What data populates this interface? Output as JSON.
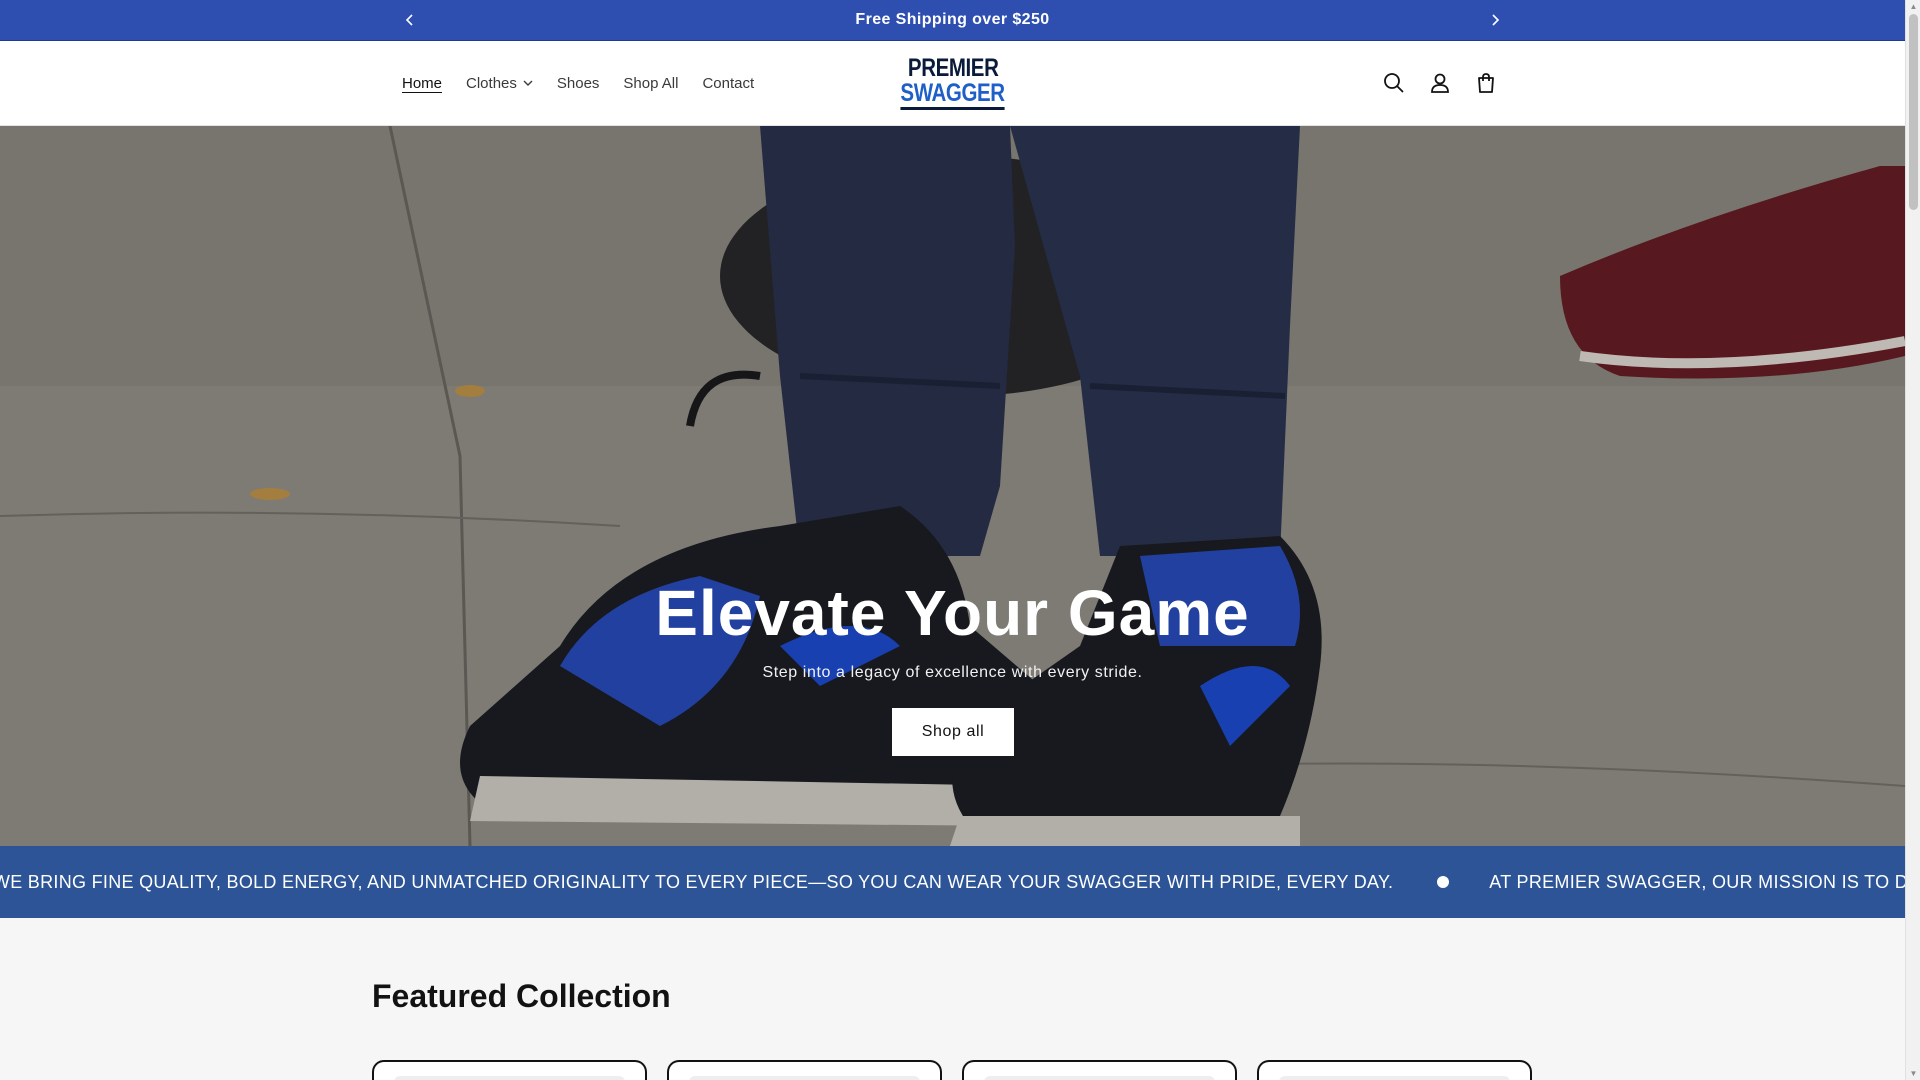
{
  "announcement": {
    "text": "Free Shipping over $250"
  },
  "nav": {
    "items": [
      {
        "label": "Home",
        "active": true
      },
      {
        "label": "Clothes",
        "has_dropdown": true
      },
      {
        "label": "Shoes"
      },
      {
        "label": "Shop All"
      },
      {
        "label": "Contact"
      }
    ]
  },
  "logo": {
    "line1": "PREMIER",
    "line2": "SWAGGER"
  },
  "header_icons": [
    "search-icon",
    "account-icon",
    "cart-icon"
  ],
  "hero": {
    "title": "Elevate Your Game",
    "subtitle": "Step into a legacy of excellence with every stride.",
    "button_label": "Shop all"
  },
  "marquee": {
    "text_1": "E. WE BRING FINE QUALITY, BOLD ENERGY, AND UNMATCHED ORIGINALITY TO EVERY PIECE—SO YOU CAN WEAR YOUR SWAGGER WITH PRIDE, EVERY DAY.",
    "text_2": "AT PREMIER SWAGGER, OUR MISSION IS TO DELIVER AUTHENTIC, PREMIUM A"
  },
  "featured": {
    "title": "Featured Collection"
  },
  "colors": {
    "announcement_bg": "#2f4fb0",
    "marquee_bg": "#2c5497",
    "page_bg": "#f6f6f6"
  }
}
